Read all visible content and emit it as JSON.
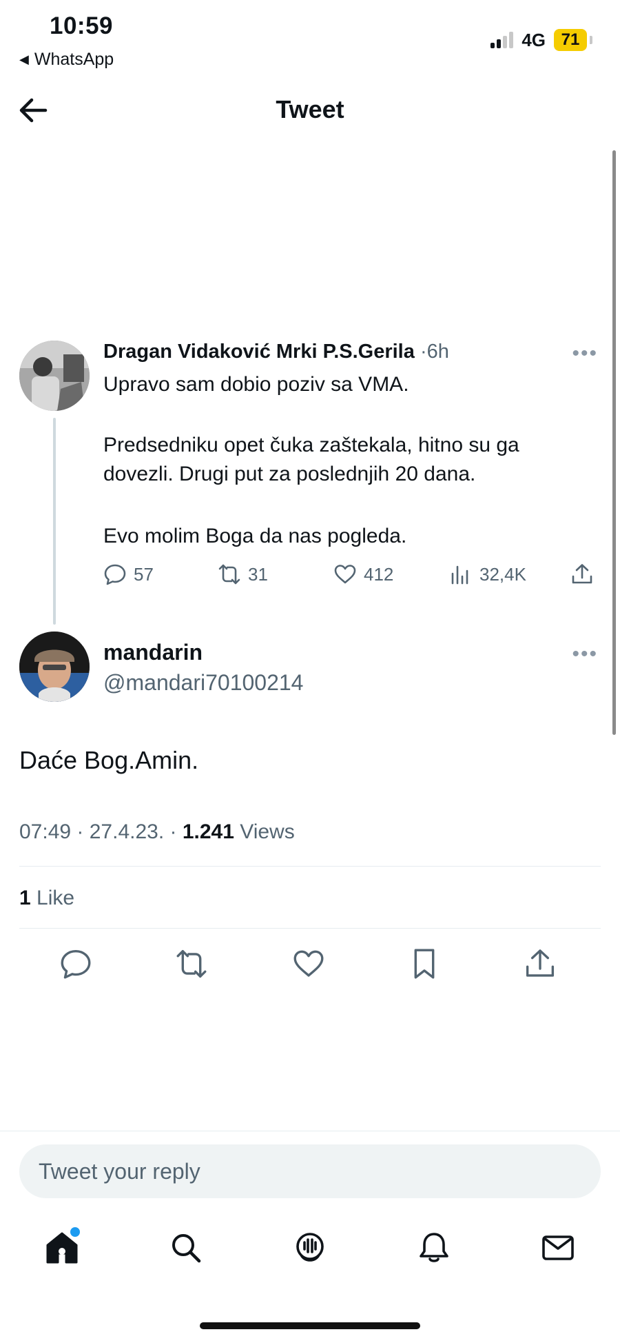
{
  "status_bar": {
    "time": "10:59",
    "back_app": "WhatsApp",
    "network": "4G",
    "battery": "71",
    "battery_color": "#f5cc00"
  },
  "header": {
    "title": "Tweet"
  },
  "parent_tweet": {
    "author_name": "Dragan Vidaković Mrki P.S.Gerila",
    "time_separator": "·",
    "age": "6h",
    "line1": "Upravo sam dobio poziv sa VMA.",
    "line2": "Predsedniku opet čuka zaštekala, hitno su ga",
    "line3": "dovezli. Drugi put za poslednjih 20 dana.",
    "line4": "Evo molim Boga da nas pogleda.",
    "replies": "57",
    "retweets": "31",
    "likes": "412",
    "views": "32,4K"
  },
  "reply_tweet": {
    "author_name": "mandarin",
    "handle": "@mandari70100214",
    "text": "Daće Bog.Amin.",
    "time": "07:49 · 27.4.23. · ",
    "views_count": "1.241",
    "views_label": " Views",
    "like_count": "1",
    "like_label": " Like"
  },
  "reply_bar": {
    "placeholder": "Tweet your reply"
  },
  "more_label": "•••",
  "colors": {
    "accent": "#1d9bf0",
    "text": "#0f1419",
    "secondary": "#536471"
  }
}
